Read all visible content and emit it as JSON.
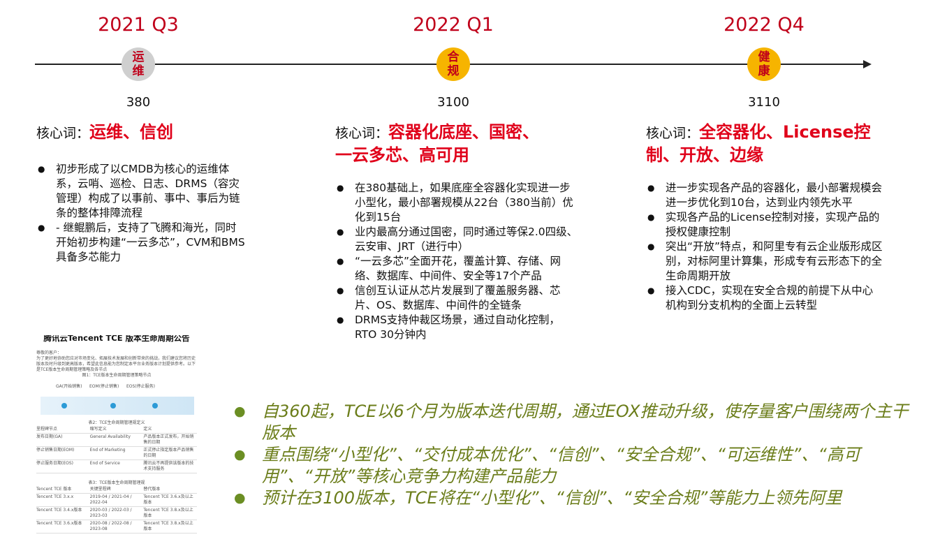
{
  "timeline": [
    {
      "quarter": "2021 Q3",
      "node_chars": [
        "运",
        "维"
      ],
      "version": "380"
    },
    {
      "quarter": "2022 Q1",
      "node_chars": [
        "合",
        "规"
      ],
      "version": "3100"
    },
    {
      "quarter": "2022 Q4",
      "node_chars": [
        "健",
        "康"
      ],
      "version": "3110"
    }
  ],
  "columns": [
    {
      "core_prefix": "核心词：",
      "core_line1": "运维、信创",
      "core_line2": "",
      "bullets": [
        "初步形成了以CMDB为核心的运维体系，云哨、巡检、日志、DRMS（容灾管理）构成了以事前、事中、事后为链条的整体排障流程",
        "- 继鲲鹏后，支持了飞腾和海光，同时开始初步构建“一云多芯”，CVM和BMS具备多芯能力"
      ]
    },
    {
      "core_prefix": "核心词：",
      "core_line1": "容器化底座、国密、",
      "core_line2": "一云多芯、高可用",
      "bullets": [
        "在380基础上，如果底座全容器化实现进一步小型化，最小部署规模从22台（380当前）优化到15台",
        "业内最高分通过国密，同时通过等保2.0四级、云安审、JRT（进行中）",
        "“一云多芯”全面开花，覆盖计算、存储、网络、数据库、中间件、安全等17个产品",
        "信创互认证从芯片发展到了覆盖服务器、芯片、OS、数据库、中间件的全链条",
        "DRMS支持仲裁区场景，通过自动化控制，RTO 30分钟内"
      ]
    },
    {
      "core_prefix": "核心词：",
      "core_line1": "全容器化、License控",
      "core_line2": "制、开放、边缘",
      "bullets": [
        "进一步实现各产品的容器化，最小部署规模会进一步优化到10台，达到业内领先水平",
        "实现各产品的License控制对接，实现产品的授权健康控制",
        "突出“开放”特点，和阿里专有云企业版形成区别，对标阿里计算集，形成专有云形态下的全生命周期开放",
        "接入CDC，实现在安全合规的前提下从中心机构到分支机构的全面上云转型"
      ]
    }
  ],
  "notice": {
    "title": "腾讯云Tencent TCE 版本生命周期公告",
    "intro": "尊敬的客户：",
    "para": "为了更好地协助您应对市场变化、拓展技术发展和创新带来的挑战，我们建议您将历史版本及时升级到更高版本，希望此信息能为您制定本平台业务版本计划提供参考。以下是TCE版本生命周期管理策略及各节点",
    "fig1": "图1：TCE版本生命周期管理策略节点",
    "stages": [
      "GA(开始销售)",
      "EOM(停止销售)",
      "EOS(停止服务)"
    ],
    "table2_title": "表2：TCE生命周期管理规定义",
    "table2_rows": [
      [
        "里程碑节点",
        "缩写定义",
        "定义"
      ],
      [
        "发布日期(GA)",
        "General Availability",
        "产品版本正式发布，开始销售的日期"
      ],
      [
        "停止销售日期(EOM)",
        "End of Marketing",
        "正式停止指定版本产品销售的日期"
      ],
      [
        "停止服务日期(EOS)",
        "End of Service",
        "腾讯云不再提供该版本的技术支持服务"
      ]
    ],
    "table3_title": "表3：TCE版本生命周期管理规",
    "table3_rows": [
      [
        "Tencent TCE 版本",
        "关键里程碑",
        "替代版本"
      ],
      [
        "Tencent TCE 3.x.x",
        "2019-04 / 2021-04 / 2022-04",
        "Tencent TCE 3.6.x及以上版本"
      ],
      [
        "Tencent TCE 3.4.x版本",
        "2020-03 / 2022-03 / 2023-03",
        "Tencent TCE 3.8.x及以上版本"
      ],
      [
        "Tencent TCE 3.6.x版本",
        "2020-08 / 2022-08 / 2023-08",
        "Tencent TCE 3.8.x及以上版本"
      ]
    ]
  },
  "summary": [
    "自360起，TCE以6个月为版本迭代周期，通过EOX推动升级，使存量客户围绕两个主干版本",
    "重点围绕“小型化”、“交付成本优化”、“信创”、“安全合规”、“可运维性”、“高可用”、“开放”等核心竞争力构建产品能力",
    "预计在3100版本，TCE将在“小型化”、“信创”、“安全合规”等能力上领先阿里"
  ],
  "colors": {
    "accent_red": "#e0001a",
    "quarter_red": "#c0001a",
    "node_gray": "#cfcfcf",
    "node_orange": "#f6b400",
    "summary_green": "#6b7d1a"
  }
}
